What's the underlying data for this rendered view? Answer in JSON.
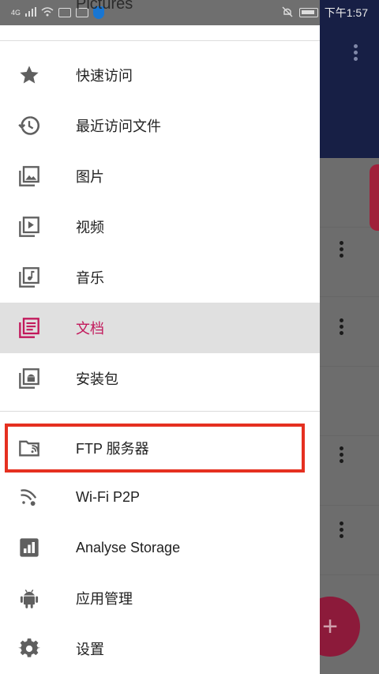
{
  "status_bar": {
    "network": "4G",
    "time": "下午1:57"
  },
  "background": {
    "title_partial": "Pictures",
    "fab_symbol": "+"
  },
  "drawer": {
    "items": [
      {
        "label": "快速访问",
        "icon": "star-icon"
      },
      {
        "label": "最近访问文件",
        "icon": "history-icon"
      },
      {
        "label": "图片",
        "icon": "image-library-icon"
      },
      {
        "label": "视频",
        "icon": "video-library-icon"
      },
      {
        "label": "音乐",
        "icon": "music-library-icon"
      },
      {
        "label": "文档",
        "icon": "document-library-icon",
        "active": true
      },
      {
        "label": "安装包",
        "icon": "android-package-icon"
      }
    ],
    "tools": [
      {
        "label": "FTP 服务器",
        "icon": "ftp-folder-icon",
        "highlighted": true
      },
      {
        "label": "Wi-Fi P2P",
        "icon": "wifi-p2p-icon"
      },
      {
        "label": "Analyse Storage",
        "icon": "storage-chart-icon"
      },
      {
        "label": "应用管理",
        "icon": "android-icon"
      },
      {
        "label": "设置",
        "icon": "gear-icon"
      }
    ]
  },
  "colors": {
    "accent": "#c2185b",
    "highlight_box": "#e53020",
    "header_bg": "#1f2a5c"
  }
}
